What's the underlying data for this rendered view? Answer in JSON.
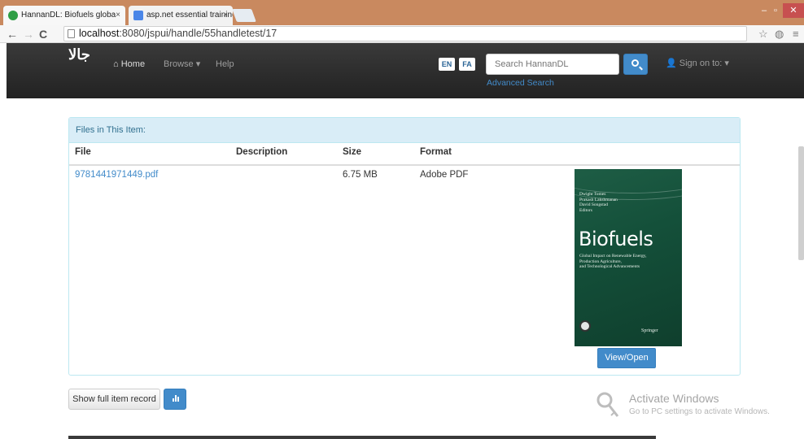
{
  "browser": {
    "tabs": [
      {
        "title": "HannanDL: Biofuels globa",
        "active": true,
        "favicon_color": "#2e9e44"
      },
      {
        "title": "asp.net essential training",
        "active": false,
        "favicon_color": "#4a86e8"
      }
    ],
    "url_host": "localhost",
    "url_path": ":8080/jspui/handle/55handletest/17",
    "close_glyph": "×"
  },
  "navbar": {
    "logo": "جالا",
    "home_label": "Home",
    "browse_label": "Browse",
    "help_label": "Help",
    "lang_en": "EN",
    "lang_fa": "FA",
    "search_placeholder": "Search HannanDL",
    "advanced_search": "Advanced Search",
    "sign_on": "Sign on to:"
  },
  "files_panel": {
    "heading": "Files in This Item:",
    "columns": [
      "File",
      "Description",
      "Size",
      "Format"
    ],
    "rows": [
      {
        "file": "9781441971449.pdf",
        "description": "",
        "size": "6.75 MB",
        "format": "Adobe PDF"
      }
    ],
    "view_open_label": "View/Open"
  },
  "book_cover": {
    "editors": "Dwight Tomes\nPrakash Lakshmanan\nDavid Songstad\nEditors",
    "title": "Biofuels",
    "subtitle": "Global Impact on Renewable Energy,\nProduction Agriculture,\nand Technological Advancements",
    "publisher": "Springer"
  },
  "actions": {
    "full_record_label": "Show full item record"
  },
  "watermark": {
    "title": "Activate Windows",
    "subtitle": "Go to PC settings to activate Windows."
  }
}
